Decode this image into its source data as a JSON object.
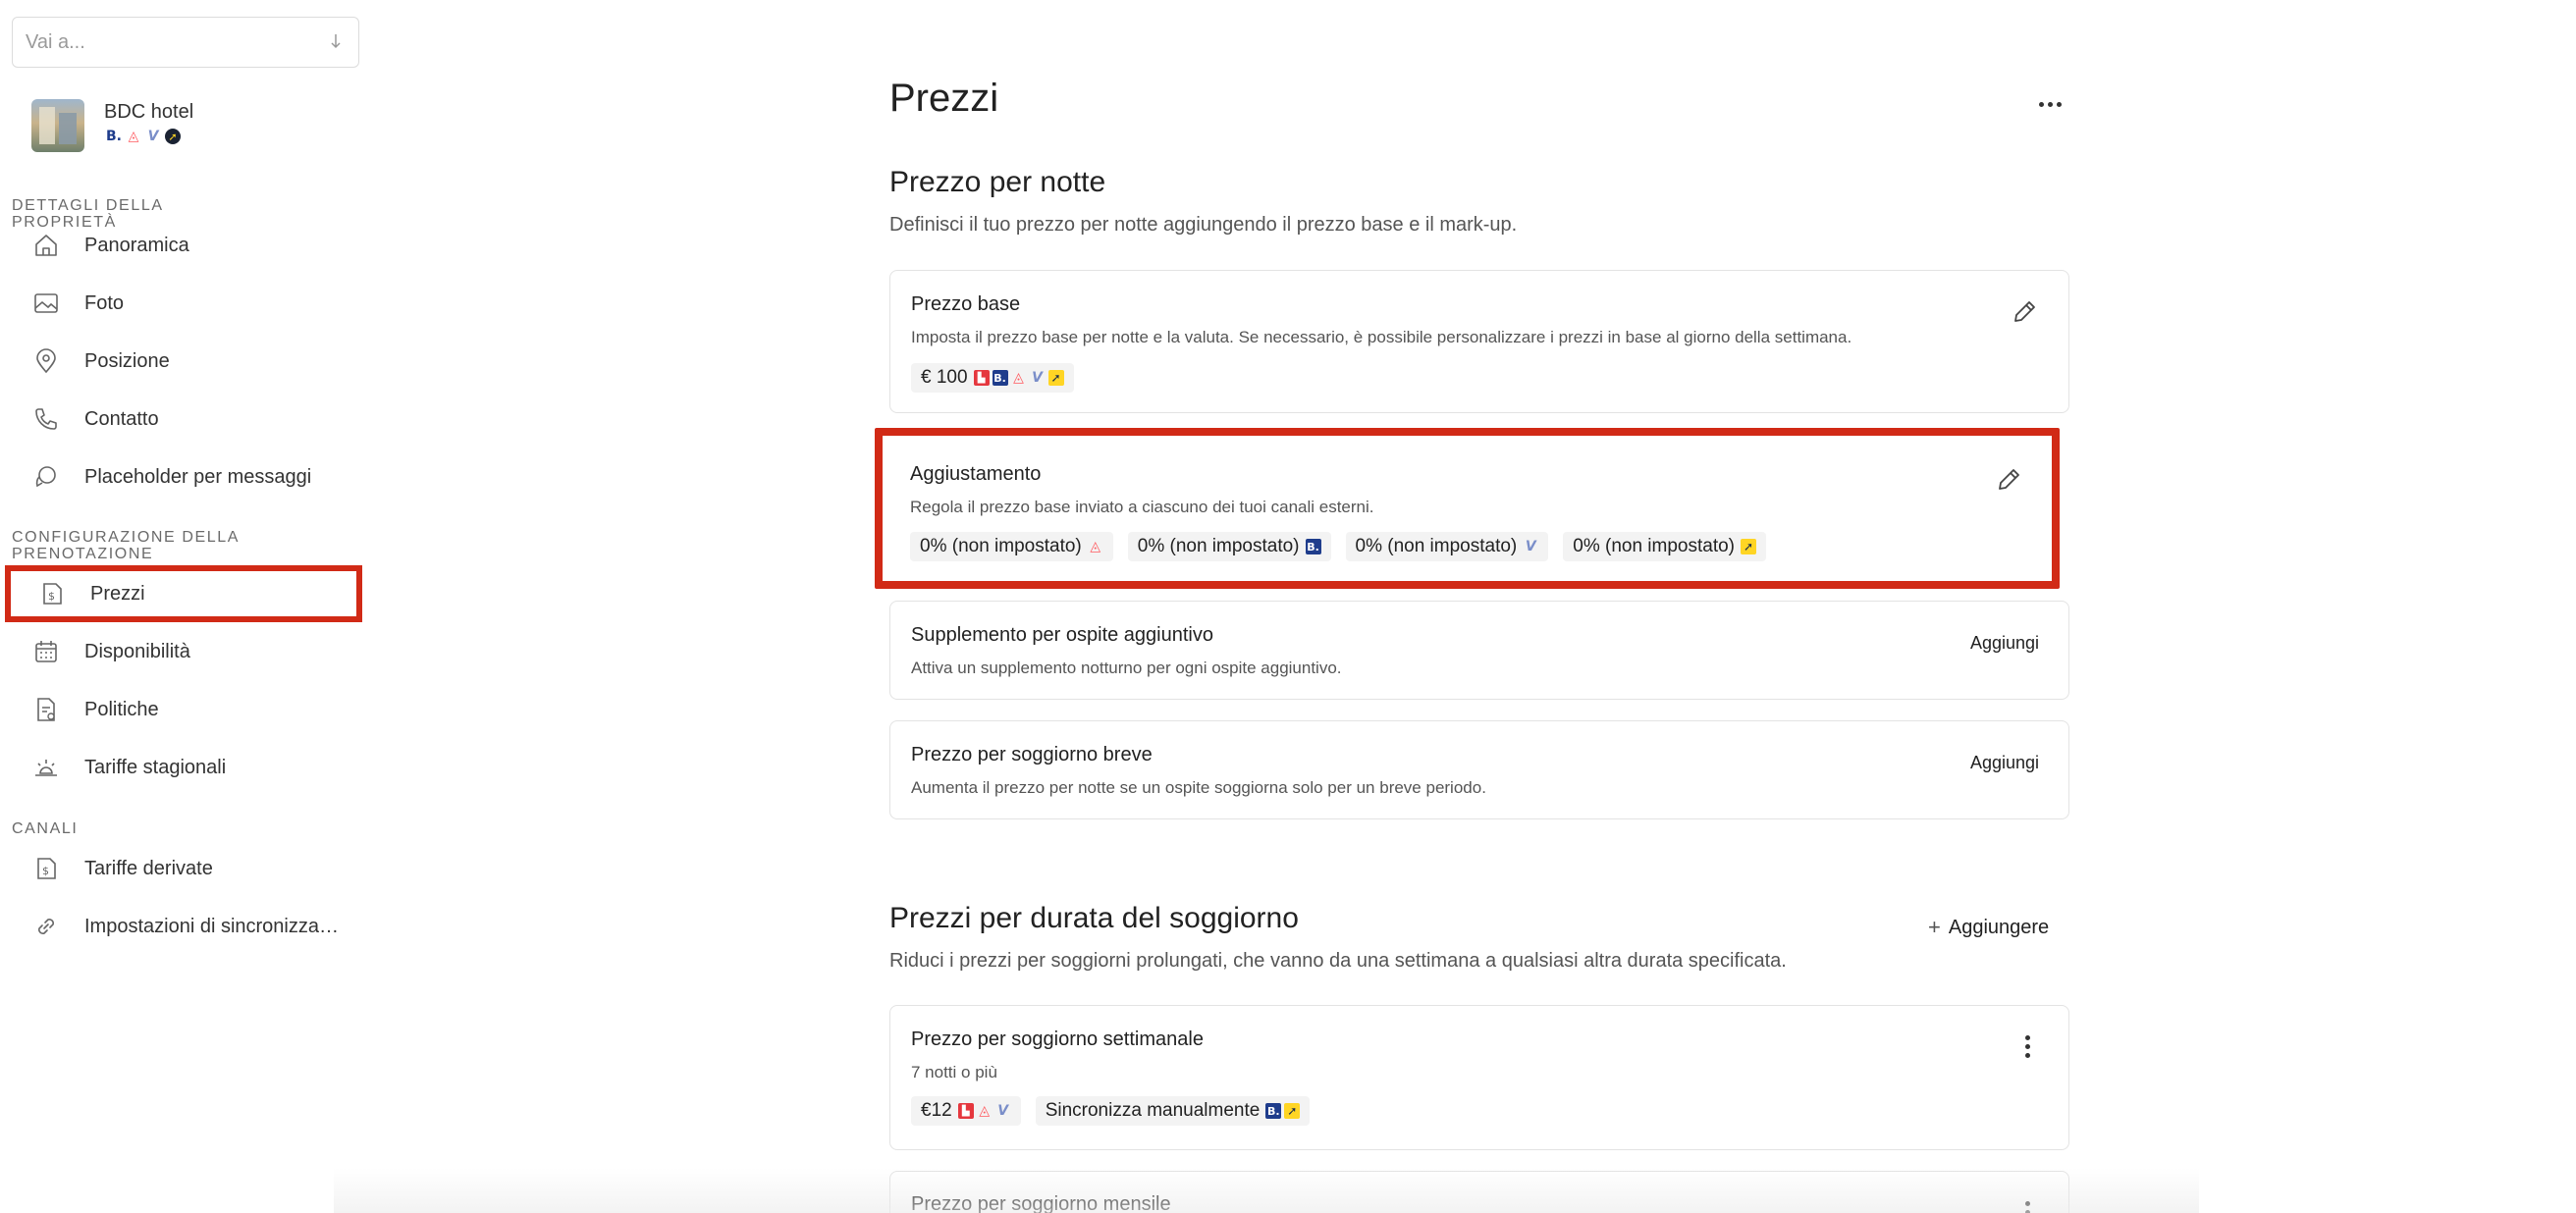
{
  "search": {
    "placeholder": "Vai a..."
  },
  "property": {
    "name": "BDC hotel",
    "channel_icons": [
      "booking-icon",
      "airbnb-icon",
      "vrbo-icon",
      "expedia-icon"
    ]
  },
  "sidebar": {
    "section_property": "DETTAGLI DELLA PROPRIETÀ",
    "section_booking": "CONFIGURAZIONE DELLA PRENOTAZIONE",
    "section_channels": "CANALI",
    "items": [
      {
        "label": "Panoramica",
        "icon": "home-icon"
      },
      {
        "label": "Foto",
        "icon": "image-icon"
      },
      {
        "label": "Posizione",
        "icon": "map-pin-icon"
      },
      {
        "label": "Contatto",
        "icon": "phone-icon"
      },
      {
        "label": "Placeholder per messaggi",
        "icon": "message-icon"
      },
      {
        "label": "Prezzi",
        "icon": "price-tag-icon",
        "active": true
      },
      {
        "label": "Disponibilità",
        "icon": "calendar-icon"
      },
      {
        "label": "Politiche",
        "icon": "policy-icon"
      },
      {
        "label": "Tariffe stagionali",
        "icon": "sun-icon"
      },
      {
        "label": "Tariffe derivate",
        "icon": "derived-rate-icon"
      },
      {
        "label": "Impostazioni di sincronizza…",
        "icon": "link-icon"
      }
    ]
  },
  "main": {
    "title": "Prezzi",
    "nightly": {
      "title": "Prezzo per notte",
      "description": "Definisci il tuo prezzo per notte aggiungendo il prezzo base e il mark-up."
    },
    "base_price": {
      "title": "Prezzo base",
      "description": "Imposta il prezzo base per notte e la valuta. Se necessario, è possibile personalizzare i prezzi in base al giorno della settimana.",
      "value": "€ 100"
    },
    "adjustment": {
      "title": "Aggiustamento",
      "description": "Regola il prezzo base inviato a ciascuno dei tuoi canali esterni.",
      "chips": [
        {
          "label": "0% (non impostato)",
          "channel": "airbnb"
        },
        {
          "label": "0% (non impostato)",
          "channel": "booking"
        },
        {
          "label": "0% (non impostato)",
          "channel": "vrbo"
        },
        {
          "label": "0% (non impostato)",
          "channel": "expedia"
        }
      ]
    },
    "extra_guest": {
      "title": "Supplemento per ospite aggiuntivo",
      "description": "Attiva un supplemento notturno per ogni ospite aggiuntivo.",
      "action": "Aggiungi"
    },
    "short_stay": {
      "title": "Prezzo per soggiorno breve",
      "description": "Aumenta il prezzo per notte se un ospite soggiorna solo per un breve periodo.",
      "action": "Aggiungi"
    },
    "length_of_stay": {
      "title": "Prezzi per durata del soggiorno",
      "description": "Riduci i prezzi per soggiorni prolungati, che vanno da una settimana a qualsiasi altra durata specificata.",
      "add_label": "Aggiungere"
    },
    "weekly": {
      "title": "Prezzo per soggiorno settimanale",
      "subtitle": "7 notti o più",
      "value": "€12",
      "sync_label": "Sincronizza manualmente"
    },
    "monthly": {
      "title": "Prezzo per soggiorno mensile"
    }
  }
}
